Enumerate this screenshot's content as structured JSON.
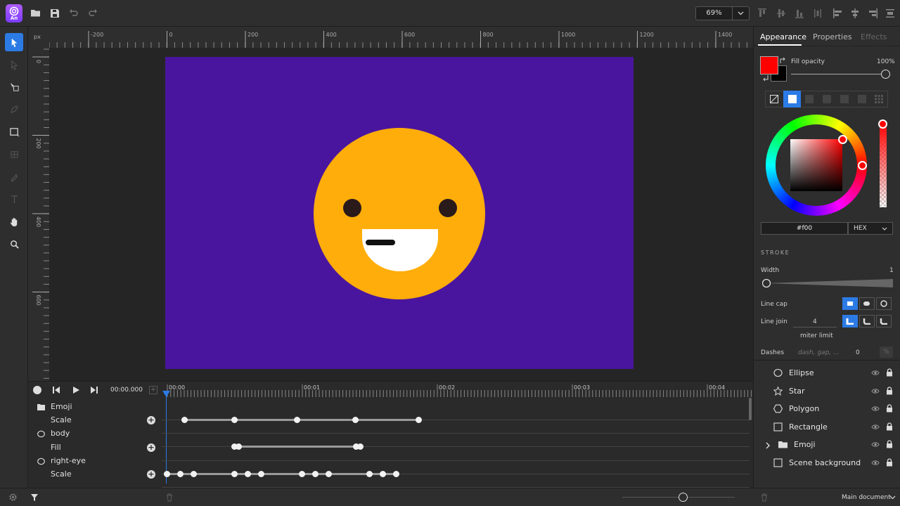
{
  "app": {
    "logo_text": "An"
  },
  "toolbar": {
    "zoom_value": "69%"
  },
  "rulers": {
    "unit": "px",
    "top_labels": [
      "-200",
      "0",
      "200",
      "400",
      "600",
      "800",
      "1000",
      "1200",
      "1400"
    ],
    "left_labels": [
      "0",
      "200",
      "400",
      "600"
    ]
  },
  "timeline": {
    "current_time": "00:00.000",
    "time_labels": [
      "00:00",
      "00:01",
      "00:02",
      "00:03",
      "00:04"
    ],
    "rows": [
      {
        "label": "Emoji",
        "icon": "folder-icon"
      },
      {
        "label": "Scale",
        "icon": ""
      },
      {
        "label": "body",
        "icon": "ellipse-icon"
      },
      {
        "label": "Fill",
        "icon": ""
      },
      {
        "label": "right-eye",
        "icon": "ellipse-icon"
      },
      {
        "label": "Scale",
        "icon": ""
      }
    ]
  },
  "panel": {
    "tabs": [
      "Appearance",
      "Properties",
      "Effects"
    ],
    "fill_opacity_label": "Fill opacity",
    "fill_opacity_value": "100%",
    "fill_opacity_fraction": 1.0,
    "fill_color": "#ff0000",
    "hex_value": "#f00",
    "color_mode": "HEX",
    "stroke_header": "STROKE",
    "width_label": "Width",
    "width_value": "1",
    "line_cap_label": "Line cap",
    "line_join_label": "Line join",
    "miter_value": "4",
    "miter_label": "miter limit",
    "dashes_label": "Dashes",
    "dashes_placeholder": "dash, gap, ...",
    "dashes_value": "0"
  },
  "layers": [
    {
      "name": "Ellipse",
      "icon": "ellipse-icon",
      "expandable": false
    },
    {
      "name": "Star",
      "icon": "star-icon",
      "expandable": false
    },
    {
      "name": "Polygon",
      "icon": "polygon-icon",
      "expandable": false
    },
    {
      "name": "Rectangle",
      "icon": "rectangle-icon",
      "expandable": false
    },
    {
      "name": "Emoji",
      "icon": "folder-icon",
      "expandable": true
    },
    {
      "name": "Scene background",
      "icon": "rectangle-icon",
      "expandable": false
    }
  ],
  "footer": {
    "document_label": "Main document"
  },
  "colors": {
    "accent": "#2c7be5",
    "stage_bg": "#4a159e",
    "emoji_face": "#ffad0a"
  }
}
